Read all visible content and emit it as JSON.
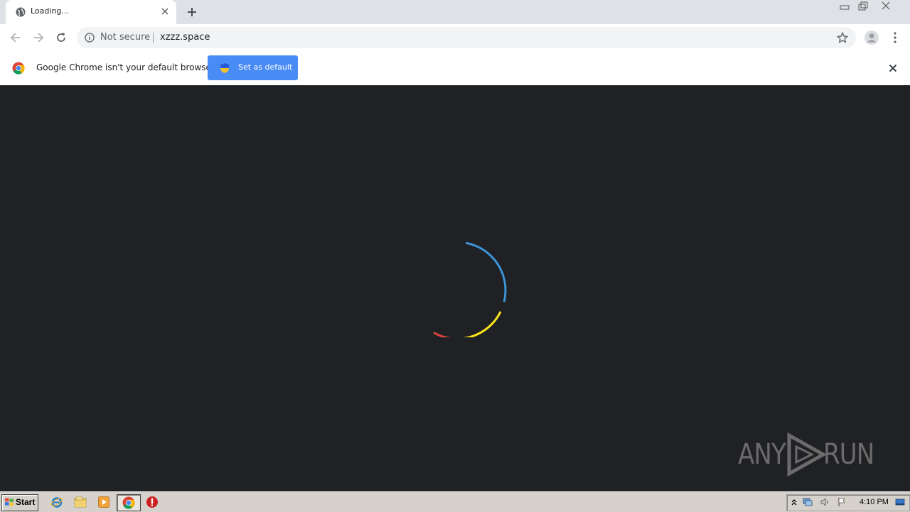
{
  "tab": {
    "title": "Loading..."
  },
  "omnibox": {
    "security_label": "Not secure",
    "url": "xzzz.space"
  },
  "infobar": {
    "message": "Google Chrome isn't your default browser",
    "button_label": "Set as default"
  },
  "spinner": {
    "colors": [
      "#3c95d8",
      "#e0443e",
      "#f7e51b"
    ]
  },
  "watermark": {
    "left_text": "ANY",
    "right_text": "RUN"
  },
  "taskbar": {
    "start_label": "Start",
    "clock": "4:10 PM"
  },
  "colors": {
    "tabstrip": "#dee1e6",
    "accent_button": "#4a8cf5",
    "page_background": "#202124"
  }
}
